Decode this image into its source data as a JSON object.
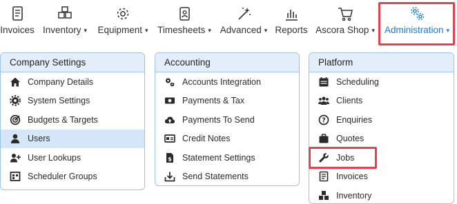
{
  "nav": {
    "items": [
      {
        "label": "Invoices",
        "icon": "invoice-book-icon"
      },
      {
        "label": "Inventory",
        "icon": "boxes-icon",
        "dropdown": true
      },
      {
        "label": "Equipment",
        "icon": "gear-icon",
        "dropdown": true
      },
      {
        "label": "Timesheets",
        "icon": "id-card-icon",
        "dropdown": true
      },
      {
        "label": "Advanced",
        "icon": "magic-wand-icon",
        "dropdown": true
      },
      {
        "label": "Reports",
        "icon": "bar-chart-icon"
      },
      {
        "label": "Ascora Shop",
        "icon": "shopping-cart-icon",
        "dropdown": true
      },
      {
        "label": "Administration",
        "icon": "gears-icon",
        "dropdown": true,
        "active": true
      }
    ],
    "caret": "▾"
  },
  "panels": {
    "company": {
      "title": "Company Settings",
      "items": [
        "Company Details",
        "System Settings",
        "Budgets & Targets",
        "Users",
        "User Lookups",
        "Scheduler Groups"
      ]
    },
    "accounting": {
      "title": "Accounting",
      "items": [
        "Accounts Integration",
        "Payments & Tax",
        "Payments To Send",
        "Credit Notes",
        "Statement Settings",
        "Send Statements"
      ]
    },
    "platform": {
      "title": "Platform",
      "items": [
        "Scheduling",
        "Clients",
        "Enquiries",
        "Quotes",
        "Jobs",
        "Invoices",
        "Inventory"
      ]
    }
  },
  "colors": {
    "accent": "#1a7bd1",
    "highlight": "#e3434f",
    "panel_header": "#e3eefa",
    "selected_row": "#d4e6f8"
  }
}
